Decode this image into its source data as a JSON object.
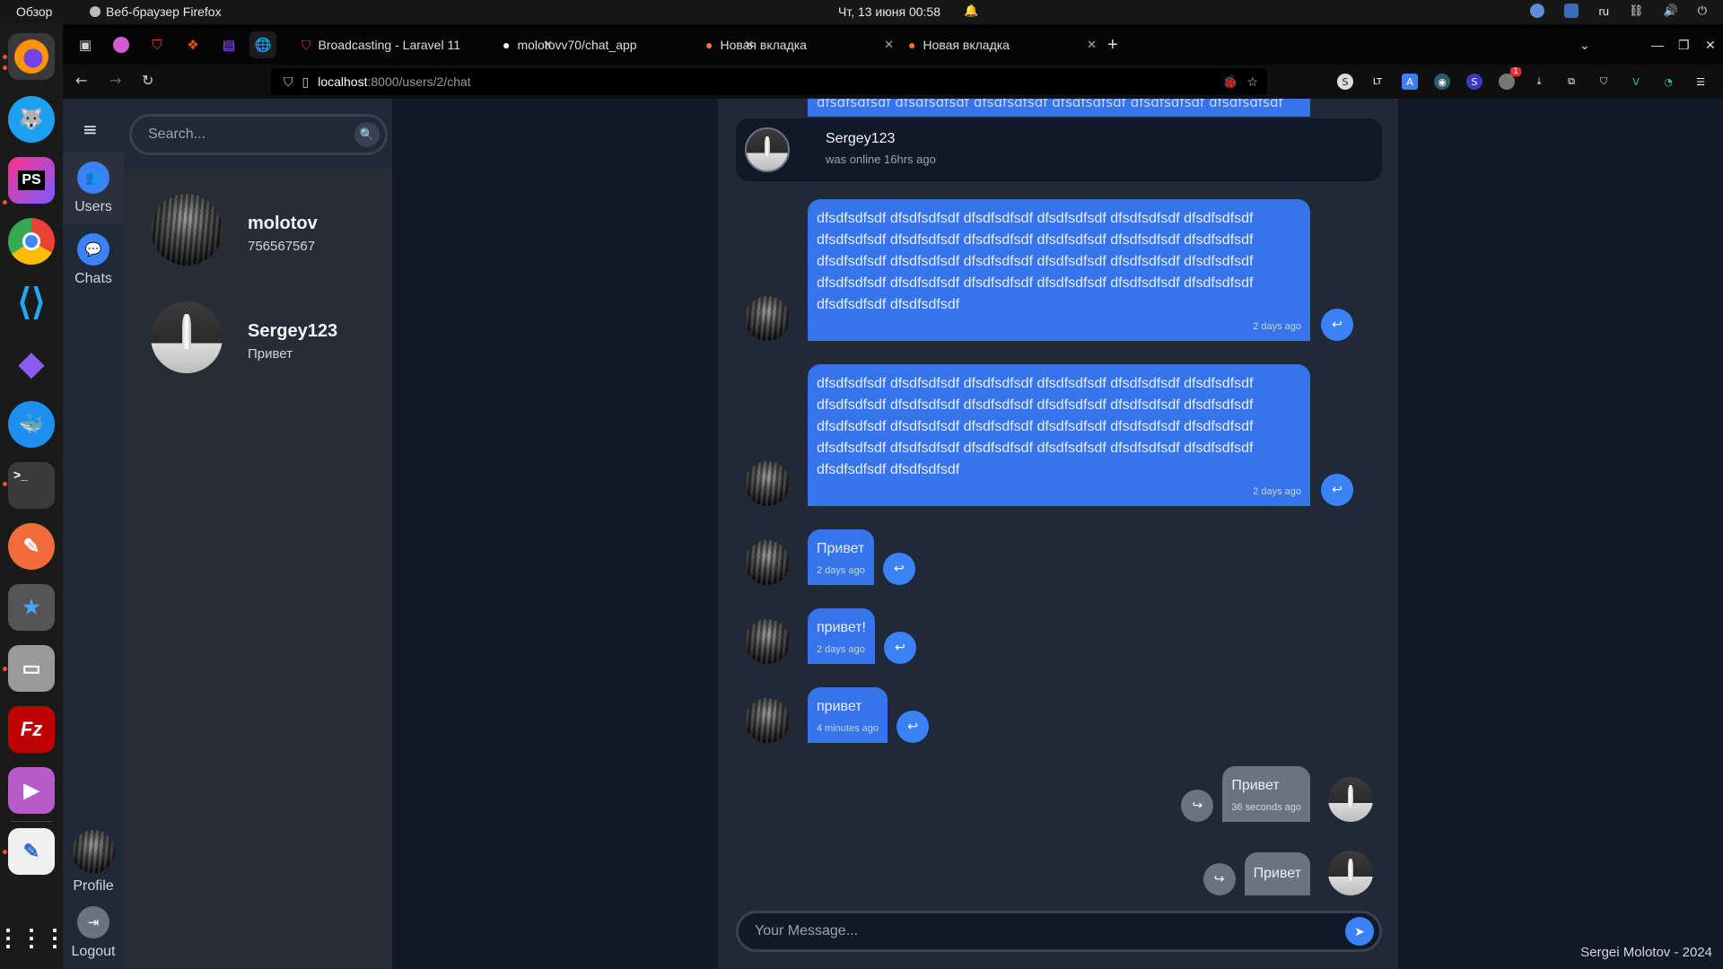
{
  "system_bar": {
    "overview": "Обзор",
    "app_name": "Веб-браузер Firefox",
    "clock": "Чт, 13 июня  00:58",
    "language": "ru"
  },
  "browser": {
    "tabs": [
      {
        "label": "Broadcasting - Laravel 11",
        "icon": "laravel-icon"
      },
      {
        "label": "molotovv70/chat_app",
        "icon": "github-icon"
      },
      {
        "label": "Новая вкладка",
        "icon": "firefox-icon"
      },
      {
        "label": "Новая вкладка",
        "icon": "firefox-icon"
      }
    ],
    "url_host": "localhost",
    "url_path": ":8000/users/2/chat",
    "extension_badge": "1"
  },
  "nav": {
    "users_label": "Users",
    "chats_label": "Chats",
    "profile_label": "Profile",
    "logout_label": "Logout"
  },
  "search": {
    "placeholder": "Search..."
  },
  "users": [
    {
      "name": "molotov",
      "subtitle": "756567567",
      "avatar": "forest"
    },
    {
      "name": "Sergey123",
      "subtitle": "Привет",
      "avatar": "bottle"
    }
  ],
  "chat_header": {
    "name": "Sergey123",
    "status": "was online 16hrs ago"
  },
  "messages": [
    {
      "direction": "in",
      "text": "dfsdfsdfsdf dfsdfsdfsdf dfsdfsdfsdf dfsdfsdfsdf dfsdfsdfsdf dfsdfsdfsdf dfsdfsdfsdf dfsdfsdfsdf dfsdfsdfsdf dfsdfsdfsdf dfsdfsdfsdf dfsdfsdfsdf dfsdfsdfsdf dfsdfsdfsdf dfsdfsdfsdf dfsdfsdfsdf dfsdfsdfsdf dfsdfsdfsdf dfsdfsdfsdf dfsdfsdfsdf dfsdfsdfsdf dfsdfsdfsdf dfsdfsdfsdf dfsdfsdfsdf dfsdfsdfsdf dfsdfsdfsdf",
      "time": "2 days ago"
    },
    {
      "direction": "in",
      "text": "dfsdfsdfsdf dfsdfsdfsdf dfsdfsdfsdf dfsdfsdfsdf dfsdfsdfsdf dfsdfsdfsdf dfsdfsdfsdf dfsdfsdfsdf dfsdfsdfsdf dfsdfsdfsdf dfsdfsdfsdf dfsdfsdfsdf dfsdfsdfsdf dfsdfsdfsdf dfsdfsdfsdf dfsdfsdfsdf dfsdfsdfsdf dfsdfsdfsdf dfsdfsdfsdf dfsdfsdfsdf dfsdfsdfsdf dfsdfsdfsdf dfsdfsdfsdf dfsdfsdfsdf dfsdfsdfsdf dfsdfsdfsdf",
      "time": "2 days ago"
    },
    {
      "direction": "in",
      "text": "Привет",
      "time": "2 days ago"
    },
    {
      "direction": "in",
      "text": "привет!",
      "time": "2 days ago"
    },
    {
      "direction": "in",
      "text": "привет",
      "time": "4 minutes ago"
    },
    {
      "direction": "out",
      "text": "Привет",
      "time": "36 seconds ago"
    },
    {
      "direction": "out",
      "text": "Привет",
      "time": ""
    }
  ],
  "bleed_text": "dfsdfsdfsdf dfsdfsdfsdf dfsdfsdfsdf dfsdfsdfsdf dfsdfsdfsdf dfsdfsdfsdf",
  "composer": {
    "placeholder": "Your Message..."
  },
  "footer": "Sergei Molotov - 2024",
  "colors": {
    "accent": "#3b82f6",
    "incoming_bubble": "#3574ea",
    "outgoing_bubble": "#6b7280"
  }
}
